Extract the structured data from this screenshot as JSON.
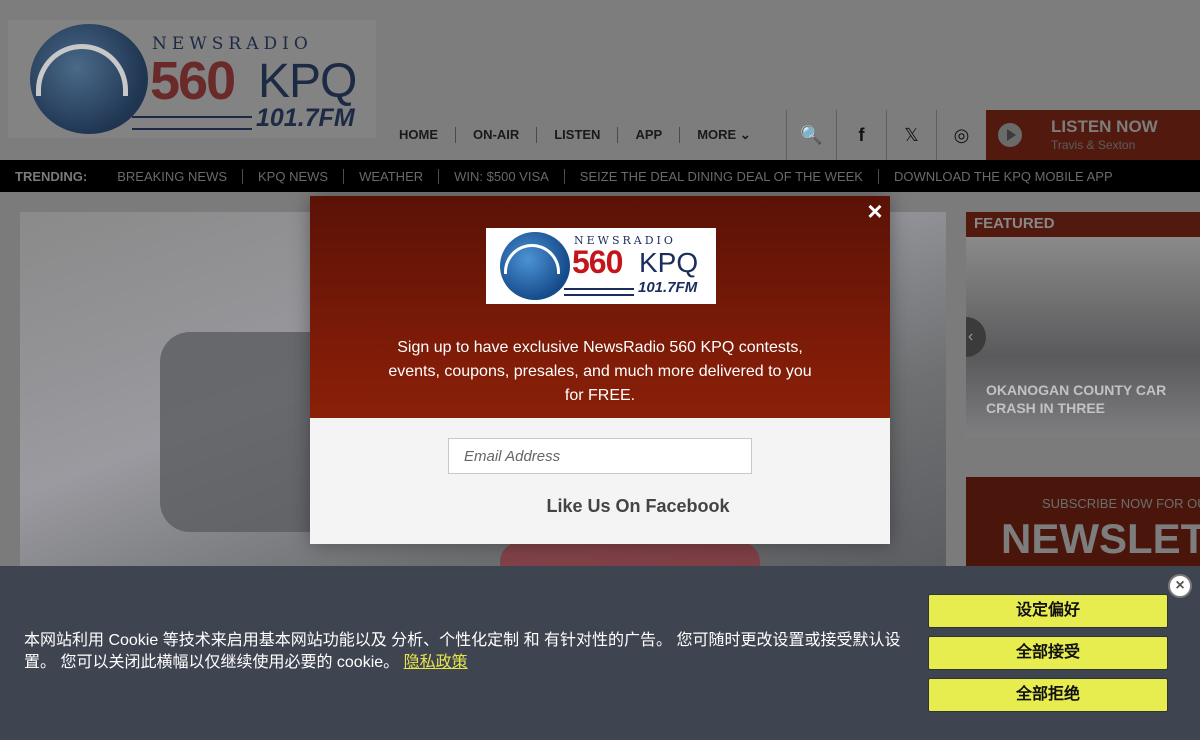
{
  "header": {
    "logo": {
      "line1": "NEWSRADIO",
      "number": "560",
      "call": "KPQ",
      "freq": "101.7FM"
    },
    "nav": [
      "HOME",
      "ON-AIR",
      "LISTEN",
      "APP",
      "MORE"
    ],
    "icons": {
      "search": "🔍",
      "facebook": "f",
      "x": "𝕏",
      "instagram": "◎"
    },
    "listen_now": {
      "title": "LISTEN NOW",
      "subtitle": "Travis & Sexton"
    }
  },
  "trending": {
    "label": "TRENDING:",
    "items": [
      "BREAKING NEWS",
      "KPQ NEWS",
      "WEATHER",
      "WIN: $500 VISA",
      "SEIZE THE DEAL DINING DEAL OF THE WEEK",
      "DOWNLOAD THE KPQ MOBILE APP"
    ]
  },
  "featured": {
    "label": "FEATURED",
    "caption": "OKANOGAN COUNTY CAR CRASH IN THREE",
    "arrow": "‹"
  },
  "newsletter": {
    "subtitle": "SUBSCRIBE NOW FOR OUR",
    "title": "NEWSLETTE"
  },
  "modal": {
    "close": "×",
    "logo": {
      "line1": "NEWSRADIO",
      "number": "560",
      "call": "KPQ",
      "freq": "101.7FM"
    },
    "text": "Sign up to have exclusive NewsRadio 560 KPQ contests, events, coupons, presales, and much more delivered to you for FREE.",
    "email_placeholder": "Email Address",
    "facebook": "Like Us On Facebook"
  },
  "cookie": {
    "text": "本网站利用 Cookie 等技术来启用基本网站功能以及 分析、个性化定制 和 有针对性的广告。 您可随时更改设置或接受默认设置。 您可以关闭此横幅以仅继续使用必要的 cookie。",
    "link": "隐私政策",
    "close": "×",
    "buttons": [
      "设定偏好",
      "全部接受",
      "全部拒绝"
    ]
  }
}
